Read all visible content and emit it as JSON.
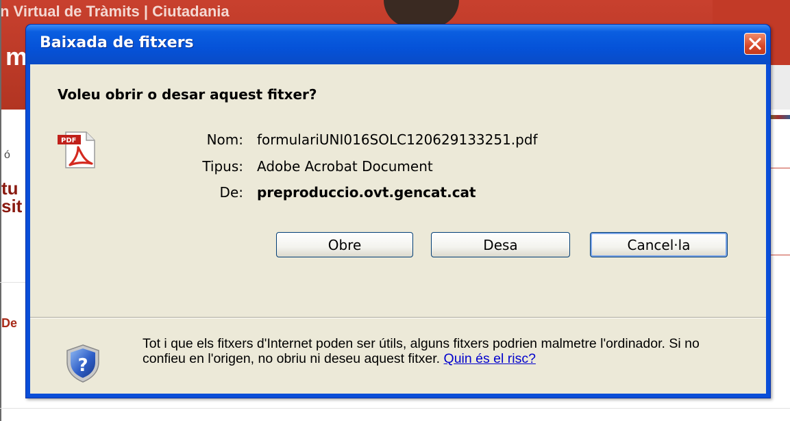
{
  "background_page": {
    "header_title": "n Virtual de Tràmits | Ciutadania",
    "header_big": "m",
    "side_text_small": "ó",
    "side_text_bold_1": "tu",
    "side_text_bold_2": "sit",
    "side_text_de": "De"
  },
  "dialog": {
    "title": "Baixada de fitxers",
    "question": "Voleu obrir o desar aquest fitxer?",
    "fields": {
      "name_label": "Nom:",
      "name_value": "formulariUNI016SOLC120629133251.pdf",
      "type_label": "Tipus:",
      "type_value": "Adobe Acrobat Document",
      "from_label": "De:",
      "from_value": "preproduccio.ovt.gencat.cat"
    },
    "buttons": {
      "open": "Obre",
      "save": "Desa",
      "cancel": "Cancel·la"
    },
    "warning_text": "Tot i que els fitxers d'Internet poden ser útils, alguns fitxers podrien malmetre l'ordinador. Si no confieu en l'origen, no obriu ni deseu aquest fitxer.",
    "risk_link": "Quin és el risc?",
    "icons": {
      "file_icon": "pdf-file-icon",
      "warning_icon": "shield-question-icon",
      "close_icon": "close-icon"
    }
  },
  "colors": {
    "titlebar": "#0552d8",
    "dialog_body": "#ece9d8",
    "close_button": "#d8482a",
    "link": "#0000cc",
    "page_header": "#c8402e"
  }
}
